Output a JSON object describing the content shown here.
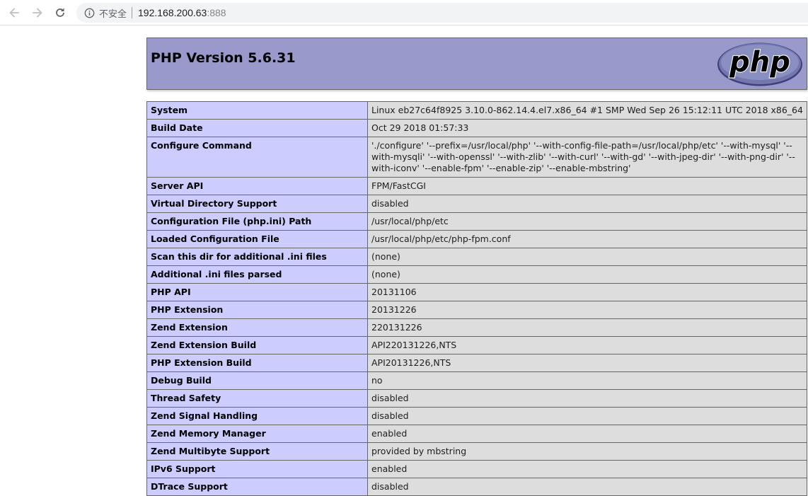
{
  "browser": {
    "back_icon": "arrow-left-icon",
    "forward_icon": "arrow-right-icon",
    "reload_icon": "reload-icon",
    "security_icon": "info-icon",
    "security_label": "不安全",
    "url_host": "192.168.200.63",
    "url_port": ":888"
  },
  "page": {
    "title": "PHP Version 5.6.31",
    "logo_text": "php",
    "colors": {
      "header_bg": "#9999cc",
      "label_bg": "#ccccff",
      "value_bg": "#dddddd"
    },
    "rows": [
      {
        "label": "System",
        "value": "Linux eb27c64f8925 3.10.0-862.14.4.el7.x86_64 #1 SMP Wed Sep 26 15:12:11 UTC 2018 x86_64"
      },
      {
        "label": "Build Date",
        "value": "Oct 29 2018 01:57:33"
      },
      {
        "label": "Configure Command",
        "value": "'./configure' '--prefix=/usr/local/php' '--with-config-file-path=/usr/local/php/etc' '--with-mysql' '--with-mysqli' '--with-openssl' '--with-zlib' '--with-curl' '--with-gd' '--with-jpeg-dir' '--with-png-dir' '--with-iconv' '--enable-fpm' '--enable-zip' '--enable-mbstring'"
      },
      {
        "label": "Server API",
        "value": "FPM/FastCGI"
      },
      {
        "label": "Virtual Directory Support",
        "value": "disabled"
      },
      {
        "label": "Configuration File (php.ini) Path",
        "value": "/usr/local/php/etc"
      },
      {
        "label": "Loaded Configuration File",
        "value": "/usr/local/php/etc/php-fpm.conf"
      },
      {
        "label": "Scan this dir for additional .ini files",
        "value": "(none)"
      },
      {
        "label": "Additional .ini files parsed",
        "value": "(none)"
      },
      {
        "label": "PHP API",
        "value": "20131106"
      },
      {
        "label": "PHP Extension",
        "value": "20131226"
      },
      {
        "label": "Zend Extension",
        "value": "220131226"
      },
      {
        "label": "Zend Extension Build",
        "value": "API220131226,NTS"
      },
      {
        "label": "PHP Extension Build",
        "value": "API20131226,NTS"
      },
      {
        "label": "Debug Build",
        "value": "no"
      },
      {
        "label": "Thread Safety",
        "value": "disabled"
      },
      {
        "label": "Zend Signal Handling",
        "value": "disabled"
      },
      {
        "label": "Zend Memory Manager",
        "value": "enabled"
      },
      {
        "label": "Zend Multibyte Support",
        "value": "provided by mbstring"
      },
      {
        "label": "IPv6 Support",
        "value": "enabled"
      },
      {
        "label": "DTrace Support",
        "value": "disabled"
      }
    ]
  }
}
